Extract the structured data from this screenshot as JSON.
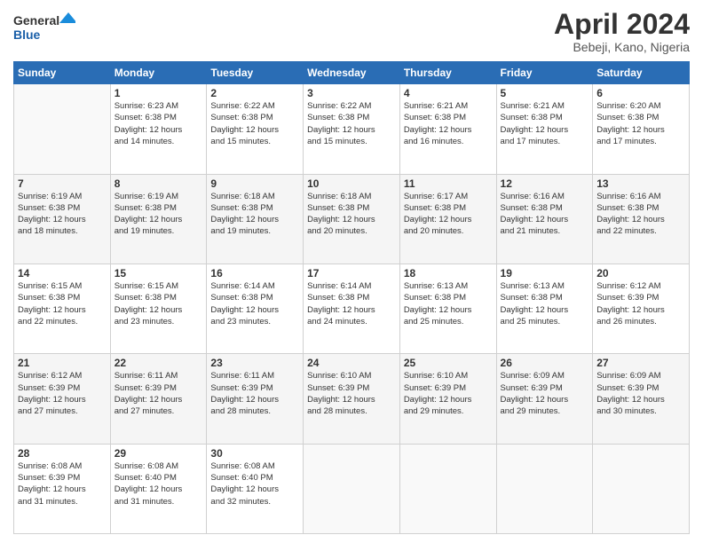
{
  "header": {
    "logo_line1": "General",
    "logo_line2": "Blue",
    "month": "April 2024",
    "location": "Bebeji, Kano, Nigeria"
  },
  "weekdays": [
    "Sunday",
    "Monday",
    "Tuesday",
    "Wednesday",
    "Thursday",
    "Friday",
    "Saturday"
  ],
  "weeks": [
    [
      {
        "day": "",
        "info": ""
      },
      {
        "day": "1",
        "info": "Sunrise: 6:23 AM\nSunset: 6:38 PM\nDaylight: 12 hours\nand 14 minutes."
      },
      {
        "day": "2",
        "info": "Sunrise: 6:22 AM\nSunset: 6:38 PM\nDaylight: 12 hours\nand 15 minutes."
      },
      {
        "day": "3",
        "info": "Sunrise: 6:22 AM\nSunset: 6:38 PM\nDaylight: 12 hours\nand 15 minutes."
      },
      {
        "day": "4",
        "info": "Sunrise: 6:21 AM\nSunset: 6:38 PM\nDaylight: 12 hours\nand 16 minutes."
      },
      {
        "day": "5",
        "info": "Sunrise: 6:21 AM\nSunset: 6:38 PM\nDaylight: 12 hours\nand 17 minutes."
      },
      {
        "day": "6",
        "info": "Sunrise: 6:20 AM\nSunset: 6:38 PM\nDaylight: 12 hours\nand 17 minutes."
      }
    ],
    [
      {
        "day": "7",
        "info": "Sunrise: 6:19 AM\nSunset: 6:38 PM\nDaylight: 12 hours\nand 18 minutes."
      },
      {
        "day": "8",
        "info": "Sunrise: 6:19 AM\nSunset: 6:38 PM\nDaylight: 12 hours\nand 19 minutes."
      },
      {
        "day": "9",
        "info": "Sunrise: 6:18 AM\nSunset: 6:38 PM\nDaylight: 12 hours\nand 19 minutes."
      },
      {
        "day": "10",
        "info": "Sunrise: 6:18 AM\nSunset: 6:38 PM\nDaylight: 12 hours\nand 20 minutes."
      },
      {
        "day": "11",
        "info": "Sunrise: 6:17 AM\nSunset: 6:38 PM\nDaylight: 12 hours\nand 20 minutes."
      },
      {
        "day": "12",
        "info": "Sunrise: 6:16 AM\nSunset: 6:38 PM\nDaylight: 12 hours\nand 21 minutes."
      },
      {
        "day": "13",
        "info": "Sunrise: 6:16 AM\nSunset: 6:38 PM\nDaylight: 12 hours\nand 22 minutes."
      }
    ],
    [
      {
        "day": "14",
        "info": "Sunrise: 6:15 AM\nSunset: 6:38 PM\nDaylight: 12 hours\nand 22 minutes."
      },
      {
        "day": "15",
        "info": "Sunrise: 6:15 AM\nSunset: 6:38 PM\nDaylight: 12 hours\nand 23 minutes."
      },
      {
        "day": "16",
        "info": "Sunrise: 6:14 AM\nSunset: 6:38 PM\nDaylight: 12 hours\nand 23 minutes."
      },
      {
        "day": "17",
        "info": "Sunrise: 6:14 AM\nSunset: 6:38 PM\nDaylight: 12 hours\nand 24 minutes."
      },
      {
        "day": "18",
        "info": "Sunrise: 6:13 AM\nSunset: 6:38 PM\nDaylight: 12 hours\nand 25 minutes."
      },
      {
        "day": "19",
        "info": "Sunrise: 6:13 AM\nSunset: 6:38 PM\nDaylight: 12 hours\nand 25 minutes."
      },
      {
        "day": "20",
        "info": "Sunrise: 6:12 AM\nSunset: 6:39 PM\nDaylight: 12 hours\nand 26 minutes."
      }
    ],
    [
      {
        "day": "21",
        "info": "Sunrise: 6:12 AM\nSunset: 6:39 PM\nDaylight: 12 hours\nand 27 minutes."
      },
      {
        "day": "22",
        "info": "Sunrise: 6:11 AM\nSunset: 6:39 PM\nDaylight: 12 hours\nand 27 minutes."
      },
      {
        "day": "23",
        "info": "Sunrise: 6:11 AM\nSunset: 6:39 PM\nDaylight: 12 hours\nand 28 minutes."
      },
      {
        "day": "24",
        "info": "Sunrise: 6:10 AM\nSunset: 6:39 PM\nDaylight: 12 hours\nand 28 minutes."
      },
      {
        "day": "25",
        "info": "Sunrise: 6:10 AM\nSunset: 6:39 PM\nDaylight: 12 hours\nand 29 minutes."
      },
      {
        "day": "26",
        "info": "Sunrise: 6:09 AM\nSunset: 6:39 PM\nDaylight: 12 hours\nand 29 minutes."
      },
      {
        "day": "27",
        "info": "Sunrise: 6:09 AM\nSunset: 6:39 PM\nDaylight: 12 hours\nand 30 minutes."
      }
    ],
    [
      {
        "day": "28",
        "info": "Sunrise: 6:08 AM\nSunset: 6:39 PM\nDaylight: 12 hours\nand 31 minutes."
      },
      {
        "day": "29",
        "info": "Sunrise: 6:08 AM\nSunset: 6:40 PM\nDaylight: 12 hours\nand 31 minutes."
      },
      {
        "day": "30",
        "info": "Sunrise: 6:08 AM\nSunset: 6:40 PM\nDaylight: 12 hours\nand 32 minutes."
      },
      {
        "day": "",
        "info": ""
      },
      {
        "day": "",
        "info": ""
      },
      {
        "day": "",
        "info": ""
      },
      {
        "day": "",
        "info": ""
      }
    ]
  ]
}
